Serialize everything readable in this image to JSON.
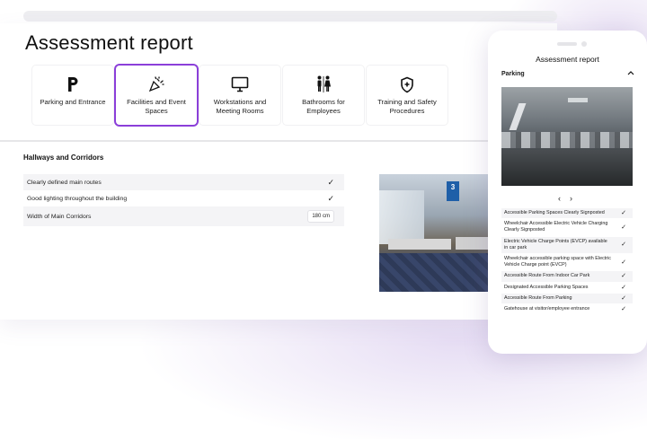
{
  "page": {
    "title": "Assessment report"
  },
  "categories": [
    {
      "label": "Parking and Entrance",
      "icon": "parking-icon",
      "active": false
    },
    {
      "label": "Facilities and Event Spaces",
      "icon": "party-popper-icon",
      "active": true
    },
    {
      "label": "Workstations and Meeting Rooms",
      "icon": "monitor-icon",
      "active": false
    },
    {
      "label": "Bathrooms for Employees",
      "icon": "restroom-icon",
      "active": false
    },
    {
      "label": "Training and Safety Procedures",
      "icon": "shield-plus-icon",
      "active": false
    }
  ],
  "section": {
    "title": "Hallways and Corridors",
    "rows": [
      {
        "label": "Clearly defined main routes",
        "check": "✓"
      },
      {
        "label": "Good lighting throughout the building",
        "check": "✓"
      },
      {
        "label": "Width of Main Corridors",
        "value": "180 cm"
      }
    ],
    "photo_sign": "3"
  },
  "phone": {
    "title": "Assessment report",
    "section_label": "Parking",
    "nav_prev": "‹",
    "nav_next": "›",
    "rows": [
      {
        "label": "Accessible Parking Spaces Clearly Signposted",
        "check": "✓"
      },
      {
        "label": "Wheelchair Accessible Electric Vehicle Charging Clearly Signposted",
        "check": "✓"
      },
      {
        "label": "Electric Vehicle Charge Points (EVCP) available in car park",
        "check": "✓"
      },
      {
        "label": "Wheelchair accessible parking space with Electric Vehicle Charge point (EVCP)",
        "check": "✓"
      },
      {
        "label": "Accessible Route From Indoor Car Park",
        "check": "✓"
      },
      {
        "label": "Designated Accessible Parking Spaces",
        "check": "✓"
      },
      {
        "label": "Accessible Route From Parking",
        "check": "✓"
      },
      {
        "label": "Gatehouse at visitor/employee entrance",
        "check": "✓"
      }
    ]
  },
  "colors": {
    "accent": "#8b3fd9"
  }
}
